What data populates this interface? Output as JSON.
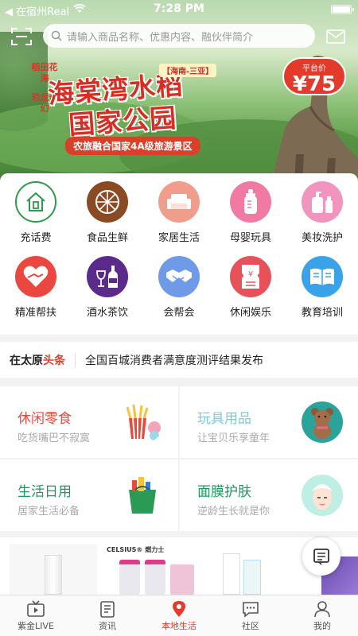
{
  "status": {
    "carrier": "◀ 在宿州Real",
    "time": "7:28 PM"
  },
  "search": {
    "placeholder": "请输入商品名称、优惠内容、融伙伴简介"
  },
  "banner": {
    "side_text": [
      "稻田花海",
      "恐龙奇幻"
    ],
    "tag": "【海南-三亚】",
    "title_line1": "海棠湾水稻",
    "title_line2": "国家公园",
    "subtitle": "农旅融合国家4A级旅游景区",
    "price_label": "平台价",
    "price": "¥75"
  },
  "categories": [
    {
      "label": "充话费",
      "icon": "home-phone-icon",
      "color": "#ffffff",
      "border": "#2e9a4c"
    },
    {
      "label": "食品生鲜",
      "icon": "fruit-slice-icon",
      "color": "#8a4a23"
    },
    {
      "label": "家居生活",
      "icon": "sofa-icon",
      "color": "#f09d8c"
    },
    {
      "label": "母婴玩具",
      "icon": "baby-bottle-icon",
      "color": "#f07aa1"
    },
    {
      "label": "美妆洗护",
      "icon": "cosmetics-icon",
      "color": "#f295be"
    },
    {
      "label": "精准帮扶",
      "icon": "heart-hands-icon",
      "color": "#e9473f"
    },
    {
      "label": "酒水茶饮",
      "icon": "wine-bottle-icon",
      "color": "#5a2b8a"
    },
    {
      "label": "会帮会",
      "icon": "handshake-icon",
      "color": "#6f9ae8"
    },
    {
      "label": "休闲娱乐",
      "icon": "ticket-icon",
      "color": "#e7525a"
    },
    {
      "label": "教育培训",
      "icon": "open-book-icon",
      "color": "#3aa2e8"
    }
  ],
  "news": {
    "brand_a": "在太原",
    "brand_b": "头条",
    "headline": "全国百城消费者满意度测评结果发布"
  },
  "promos": [
    {
      "title": "休闲零食",
      "subtitle": "吃货嘴巴不寂寞",
      "color": "#e84a3c",
      "icon": "snacks-icon"
    },
    {
      "title": "玩具用品",
      "subtitle": "让宝贝乐享童年",
      "color": "#7fc7d9",
      "icon": "teddy-bear-icon"
    },
    {
      "title": "生活日用",
      "subtitle": "居家生活必备",
      "color": "#1a9a5c",
      "icon": "shopping-bag-icon"
    },
    {
      "title": "面膜护肤",
      "subtitle": "逆龄生长就是你",
      "color": "#1a9a5c",
      "icon": "face-mask-icon"
    }
  ],
  "products": {
    "brand_text": "CELSIUS® 燃力士"
  },
  "tabs": [
    {
      "label": "紫金LIVE",
      "icon": "live-tv-icon",
      "active": false
    },
    {
      "label": "资讯",
      "icon": "news-list-icon",
      "active": false
    },
    {
      "label": "本地生活",
      "icon": "location-pin-icon",
      "active": true
    },
    {
      "label": "社区",
      "icon": "chat-bubble-icon",
      "active": false
    },
    {
      "label": "我的",
      "icon": "user-icon",
      "active": false
    }
  ],
  "colors": {
    "accent": "#e33b2e"
  }
}
